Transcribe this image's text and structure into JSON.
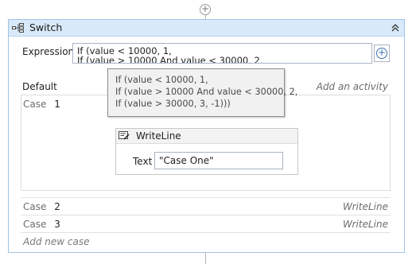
{
  "switch": {
    "title": "Switch",
    "icon": "switch-activity-icon",
    "collapse_icon": "double-chevron-up-icon"
  },
  "expression": {
    "label": "Expression",
    "value_line1": "If (value < 10000, 1,",
    "value_line2": "If (value > 10000 And value < 30000, 2,",
    "add_icon": "plus-circle-icon"
  },
  "tooltip": {
    "line1": "If (value < 10000, 1,",
    "line2": "If (value > 10000 And value < 30000, 2,",
    "line3": "If (value > 30000, 3, -1)))"
  },
  "default": {
    "label": "Default",
    "add_activity": "Add an activity"
  },
  "cases": [
    {
      "label": "Case",
      "value": "1",
      "activity": {
        "title": "WriteLine",
        "icon": "writeline-icon",
        "text_label": "Text",
        "text_value": "\"Case One\""
      }
    },
    {
      "label": "Case",
      "value": "2",
      "activity_title": "WriteLine"
    },
    {
      "label": "Case",
      "value": "3",
      "activity_title": "WriteLine"
    }
  ],
  "add_new_case": "Add new case",
  "colors": {
    "header_bg": "#d8eaf9",
    "border": "#9fc3e6"
  }
}
